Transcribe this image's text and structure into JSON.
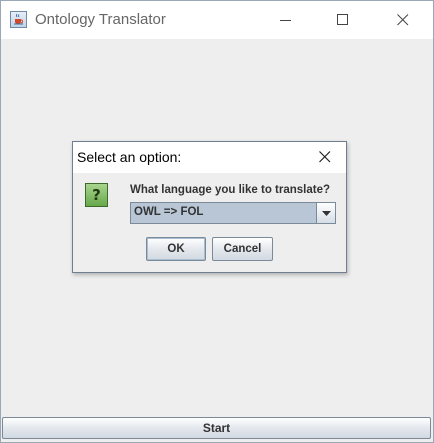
{
  "window": {
    "title": "Ontology Translator",
    "icon": "java-cup-icon",
    "controls": [
      "minimize-icon",
      "maximize-icon",
      "close-icon"
    ]
  },
  "main": {
    "start_label": "Start"
  },
  "dialog": {
    "title": "Select an option:",
    "icon": "question-icon",
    "icon_glyph": "?",
    "question": "What language you like to translate?",
    "select": {
      "value": "OWL => FOL"
    },
    "ok_label": "OK",
    "cancel_label": "Cancel"
  },
  "colors": {
    "background": "#eeeeee",
    "titlebar": "#ffffff",
    "select_bg": "#b8c6d6",
    "question_icon": "#66a84a"
  }
}
